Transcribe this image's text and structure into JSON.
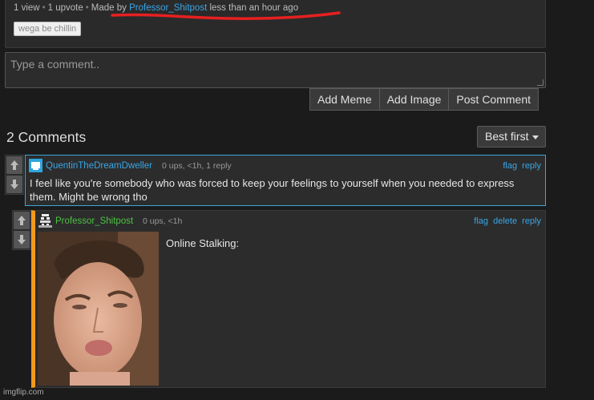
{
  "post_meta": {
    "views": "1 view",
    "upvotes": "1 upvote",
    "made_by_prefix": "Made by",
    "author": "Professor_Shitpost",
    "time": "less than an hour ago",
    "tag": "wega be chillin"
  },
  "comment_form": {
    "placeholder": "Type a comment..",
    "add_meme": "Add Meme",
    "add_image": "Add Image",
    "post_comment": "Post Comment"
  },
  "comments_header": {
    "count": "2 Comments",
    "sort": "Best first"
  },
  "comments": [
    {
      "user": "QuentinTheDreamDweller",
      "stats": "0 ups, <1h, 1 reply",
      "links": [
        "flag",
        "reply"
      ],
      "text": "I feel like you're somebody who was forced to keep your feelings to yourself when you needed to express them. Might be wrong tho"
    },
    {
      "user": "Professor_Shitpost",
      "stats": "0 ups, <1h",
      "links": [
        "flag",
        "delete",
        "reply"
      ],
      "caption": "Online Stalking:"
    }
  ],
  "watermark": "imgflip.com",
  "colors": {
    "link_blue": "#39a6e6",
    "op_green": "#4cc142",
    "reply_accent": "#f29a1a",
    "underline_red": "#e62020"
  }
}
